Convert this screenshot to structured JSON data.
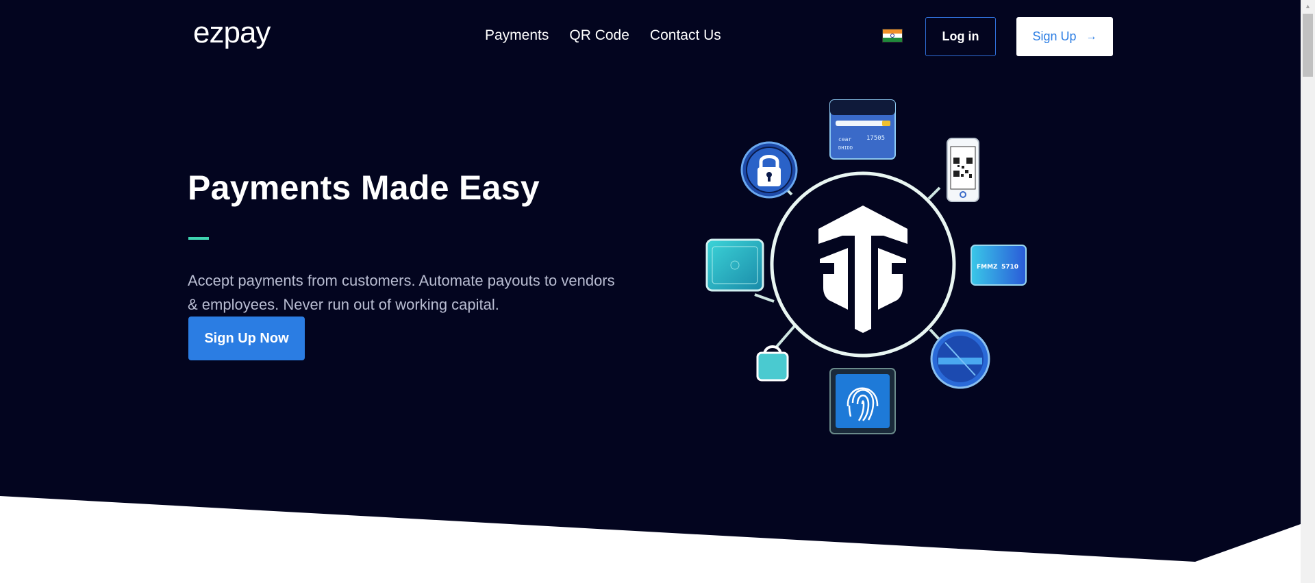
{
  "brand": {
    "logo_text": "ezpay"
  },
  "nav": {
    "links": [
      "Payments",
      "QR Code",
      "Contact Us"
    ],
    "login_label": "Log in",
    "signup_label": "Sign Up",
    "signup_arrow": "→",
    "flag": "india-flag-icon"
  },
  "hero": {
    "title": "Payments Made Easy",
    "description": "Accept payments from customers. Automate payouts to vendors & employees. Never run out of working capital.",
    "cta_label": "Sign Up Now",
    "card_text_1": "cear",
    "card_text_2": "17505",
    "card_text_3": "DHIDD",
    "card_text_4": "FMMZ",
    "card_text_5": "5710"
  },
  "colors": {
    "hero_bg": "#03051f",
    "accent_blue": "#2b7de3",
    "accent_teal": "#3fd4b1",
    "text_muted": "#b9bdd2"
  }
}
